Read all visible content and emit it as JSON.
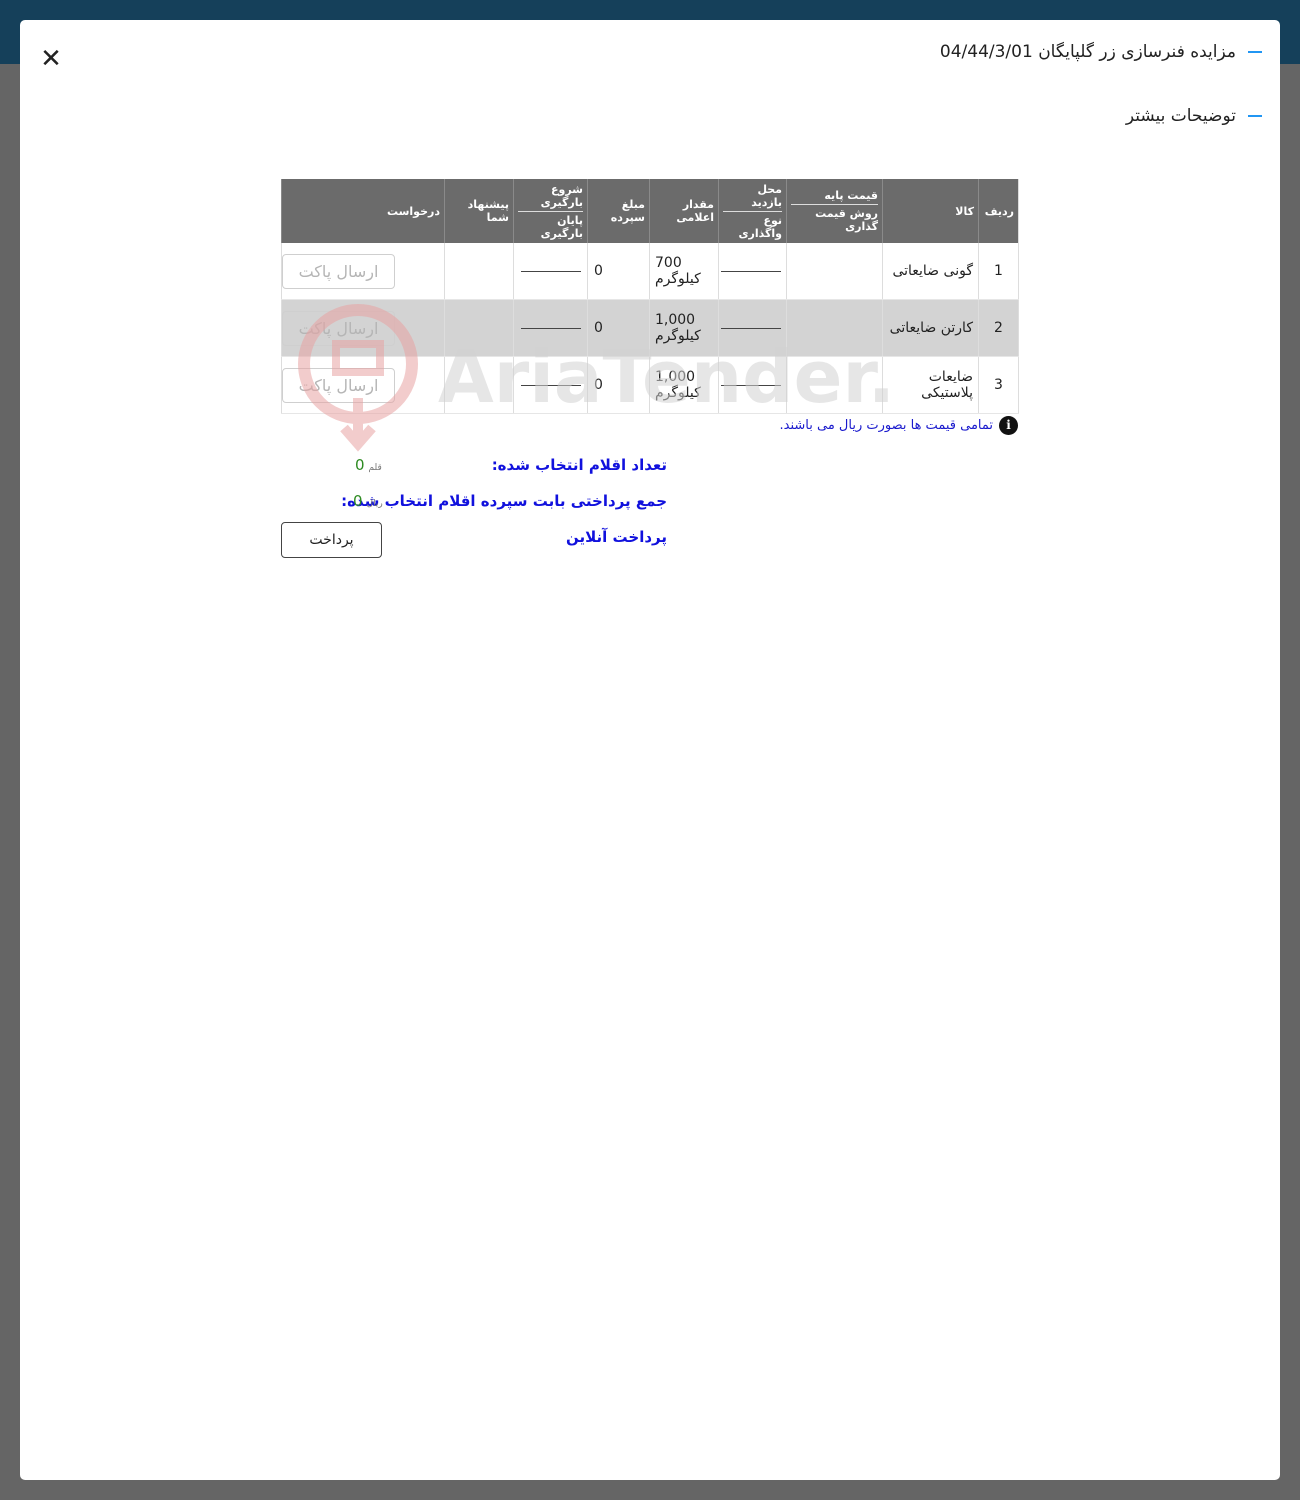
{
  "modal": {
    "title": "مزایده فنرسازی زر گلپایگان 04/44/3/01",
    "subtitle": "توضیحات بیشتر",
    "close_glyph": "✕"
  },
  "table": {
    "headers": {
      "row_no": "ردیف",
      "item": "کالا",
      "base_price": "قیمت پایه",
      "pricing_method": "روش قیمت گذاری",
      "visit_location": "محل بازدید",
      "assignment_type": "نوع واگذاری",
      "announced_qty": "مقدار اعلامی",
      "deposit": "مبلغ سپرده",
      "load_start": "شروع بارگیری",
      "load_end": "پایان بارگیری",
      "your_offer": "پیشنهاد شما",
      "request": "درخواست"
    },
    "rows": [
      {
        "no": "1",
        "item": "گونی ضایعاتی",
        "qty": "700",
        "unit": "کیلوگرم",
        "deposit": "0",
        "button": "ارسال پاکت"
      },
      {
        "no": "2",
        "item": "کارتن ضایعاتی",
        "qty": "1,000",
        "unit": "کیلوگرم",
        "deposit": "0",
        "button": "ارسال پاکت"
      },
      {
        "no": "3",
        "item": "ضایعات پلاستیکی",
        "qty": "1,000",
        "unit": "کیلوگرم",
        "deposit": "0",
        "button": "ارسال پاکت"
      }
    ]
  },
  "note": "تمامی قیمت ها بصورت ریال می باشند.",
  "watermark": "AriaTender.neT",
  "summary": {
    "selected_count_label": "تعداد اقلام انتخاب شده:",
    "selected_count_value": "0",
    "selected_count_unit": "قلم",
    "total_label": "جمع پرداختی بابت سپرده اقلام انتخاب شده:",
    "total_value": "0",
    "total_unit": "ریال",
    "online_payment_label": "پرداخت آنلاین",
    "pay_button": "پرداخت"
  },
  "colors": {
    "topbar": "#15405a",
    "backdrop": "#656565",
    "accent_dash": "#2196f3",
    "summary_text": "#1111dd",
    "value_green": "#2e8b22"
  }
}
